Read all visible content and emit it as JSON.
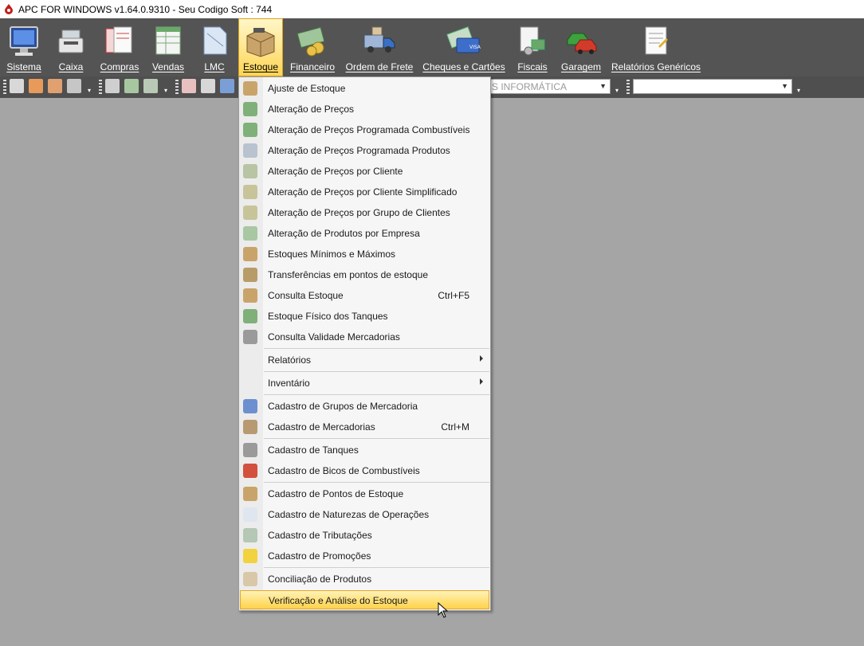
{
  "window": {
    "title": "APC FOR WINDOWS v1.64.0.9310 - Seu Codigo Soft : 744"
  },
  "colors": {
    "accent": "#ffd24a",
    "menu_bg": "#f6f6f6",
    "toolbar_bg": "#545454",
    "workspace": "#a5a5a5"
  },
  "main_menu": [
    {
      "label": "Sistema",
      "icon": "monitor-icon"
    },
    {
      "label": "Caixa",
      "icon": "cash-register-icon"
    },
    {
      "label": "Compras",
      "icon": "purchase-forms-icon"
    },
    {
      "label": "Vendas",
      "icon": "sales-spreadsheet-icon"
    },
    {
      "label": "LMC",
      "icon": "document-icon"
    },
    {
      "label": "Estoque",
      "icon": "stock-box-icon",
      "active": true
    },
    {
      "label": "Financeiro",
      "icon": "money-icon"
    },
    {
      "label": "Ordem de Frete",
      "icon": "truck-icon"
    },
    {
      "label": "Cheques e Cartões",
      "icon": "credit-card-icon"
    },
    {
      "label": "Fiscais",
      "icon": "fiscal-icon"
    },
    {
      "label": "Garagem",
      "icon": "cars-icon"
    },
    {
      "label": "Relatórios Genéricos",
      "icon": "report-icon"
    }
  ],
  "toolbar": {
    "company_combo": "S INFORMÁTICA",
    "second_combo": ""
  },
  "estoque_menu": [
    {
      "label": "Ajuste de Estoque",
      "icon": "boxes-icon"
    },
    {
      "label": "Alteração de Preços",
      "icon": "price-change-icon"
    },
    {
      "label": "Alteração de Preços Programada Combustíveis",
      "icon": "price-change-icon"
    },
    {
      "label": "Alteração de Preços Programada Produtos",
      "icon": "scheduled-price-icon"
    },
    {
      "label": "Alteração de Preços por Cliente",
      "icon": "client-price-icon"
    },
    {
      "label": "Alteração de Preços por Cliente Simplificado",
      "icon": "client-price-icon"
    },
    {
      "label": "Alteração de Preços por Grupo de Clientes",
      "icon": "group-price-icon"
    },
    {
      "label": "Alteração de Produtos por Empresa",
      "icon": "company-products-icon"
    },
    {
      "label": "Estoques Mínimos e Máximos",
      "icon": "boxes-icon"
    },
    {
      "label": "Transferências em pontos de estoque",
      "icon": "transfer-icon"
    },
    {
      "label": "Consulta Estoque",
      "icon": "boxes-icon",
      "shortcut": "Ctrl+F5"
    },
    {
      "label": "Estoque Físico dos Tanques",
      "icon": "tank-stock-icon"
    },
    {
      "label": "Consulta Validade Mercadorias",
      "icon": "safe-icon"
    },
    {
      "label": "Relatórios",
      "submenu": true
    },
    {
      "label": "Inventário",
      "submenu": true
    },
    {
      "label": "Cadastro de Grupos de Mercadoria",
      "icon": "groups-icon"
    },
    {
      "label": "Cadastro de Mercadorias",
      "icon": "stock-box-icon",
      "shortcut": "Ctrl+M"
    },
    {
      "label": "Cadastro de Tanques",
      "icon": "tank-icon"
    },
    {
      "label": "Cadastro de Bicos de Combustíveis",
      "icon": "fuel-pump-icon"
    },
    {
      "label": "Cadastro de Pontos de Estoque",
      "icon": "stock-points-icon"
    },
    {
      "label": "Cadastro de Naturezas de Operações",
      "icon": "operations-icon"
    },
    {
      "label": "Cadastro de Tributações",
      "icon": "tax-icon"
    },
    {
      "label": "Cadastro de Promoções",
      "icon": "star-icon"
    },
    {
      "label": "Conciliação de Produtos",
      "icon": "reconcile-icon"
    },
    {
      "label": "Verificação e Análise do Estoque",
      "highlighted": true
    }
  ]
}
